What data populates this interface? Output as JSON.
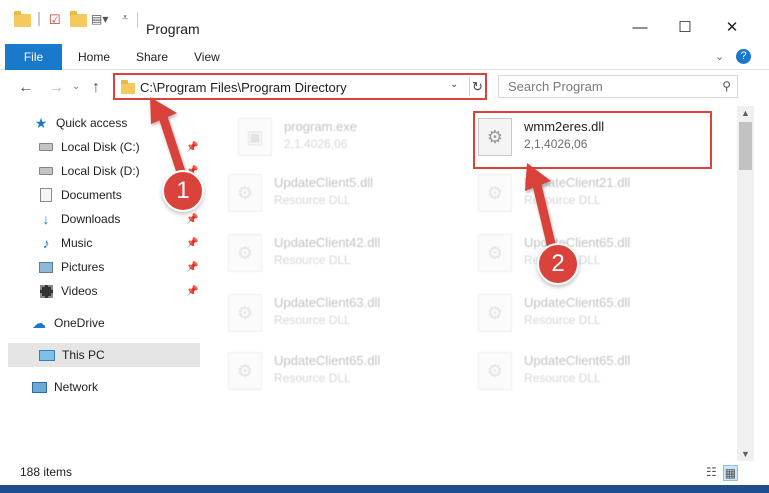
{
  "window": {
    "title": "Program",
    "controls": {
      "minimize": "—",
      "maximize": "☐",
      "close": "✕"
    }
  },
  "ribbon": {
    "tabs": [
      "File",
      "Home",
      "Share",
      "View"
    ],
    "expand_icon": "chevron-down-icon",
    "help_icon": "help-icon"
  },
  "address": {
    "path": "C:\\Program Files\\Program Directory",
    "search_placeholder": "Search Program"
  },
  "nav": {
    "items": [
      {
        "label": "Quick access",
        "icon": "star-icon",
        "pinned": false
      },
      {
        "label": "Local Disk (C:)",
        "icon": "drive-icon",
        "pinned": true
      },
      {
        "label": "Local Disk (D:)",
        "icon": "drive-icon",
        "pinned": true
      },
      {
        "label": "Documents",
        "icon": "documents-icon",
        "pinned": true
      },
      {
        "label": "Downloads",
        "icon": "download-icon",
        "pinned": true
      },
      {
        "label": "Music",
        "icon": "music-icon",
        "pinned": true
      },
      {
        "label": "Pictures",
        "icon": "pictures-icon",
        "pinned": true
      },
      {
        "label": "Videos",
        "icon": "video-icon",
        "pinned": true
      },
      {
        "label": "OneDrive",
        "icon": "cloud-icon",
        "pinned": false
      },
      {
        "label": "This PC",
        "icon": "pc-icon",
        "pinned": false,
        "selected": true
      },
      {
        "label": "Network",
        "icon": "network-icon",
        "pinned": false
      }
    ]
  },
  "files": [
    {
      "name": "program.exe",
      "sub": "2,1,4026,06",
      "faded": true
    },
    {
      "name": "wmm2eres.dll",
      "sub": "2,1,4026,06",
      "faded": false,
      "highlighted": true
    },
    {
      "name": "UpdateClient5.dll",
      "sub": "Resource DLL",
      "faded": true
    },
    {
      "name": "UpdateClient21.dll",
      "sub": "Resource DLL",
      "faded": true
    },
    {
      "name": "UpdateClient42.dll",
      "sub": "Resource DLL",
      "faded": true
    },
    {
      "name": "UpdateClient65.dll",
      "sub": "Resource DLL",
      "faded": true
    },
    {
      "name": "UpdateClient63.dll",
      "sub": "Resource DLL",
      "faded": true
    },
    {
      "name": "UpdateClient65.dll",
      "sub": "Resource DLL",
      "faded": true
    },
    {
      "name": "UpdateClient65.dll",
      "sub": "Resource DLL",
      "faded": true
    },
    {
      "name": "UpdateClient65.dll",
      "sub": "Resource DLL",
      "faded": true
    }
  ],
  "status": {
    "item_count": "188 items"
  },
  "annotations": {
    "step1": "1",
    "step2": "2",
    "color": "#d9433b"
  }
}
